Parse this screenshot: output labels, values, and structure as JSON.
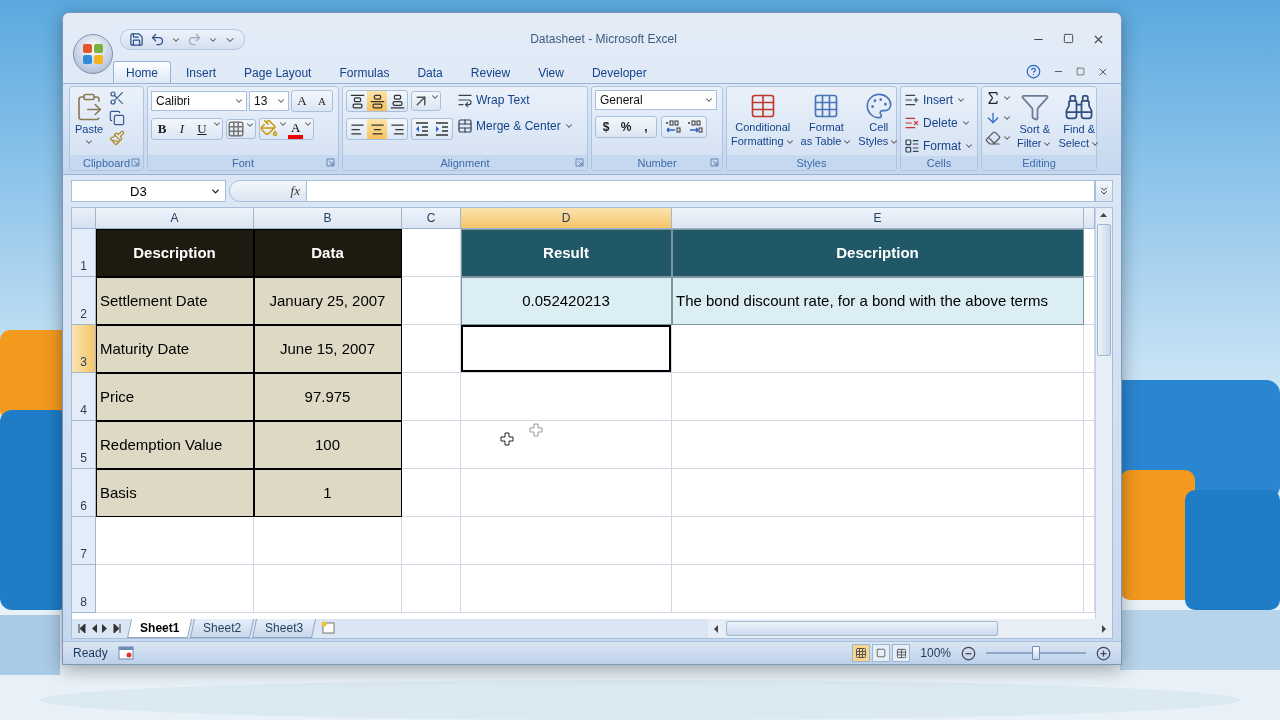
{
  "window": {
    "title": "Datasheet - Microsoft Excel"
  },
  "ribbon_tabs": [
    {
      "label": "Home",
      "selected": true
    },
    {
      "label": "Insert",
      "selected": false
    },
    {
      "label": "Page Layout",
      "selected": false
    },
    {
      "label": "Formulas",
      "selected": false
    },
    {
      "label": "Data",
      "selected": false
    },
    {
      "label": "Review",
      "selected": false
    },
    {
      "label": "View",
      "selected": false
    },
    {
      "label": "Developer",
      "selected": false
    }
  ],
  "clipboard": {
    "label": "Clipboard",
    "paste": "Paste"
  },
  "font": {
    "label": "Font",
    "name": "Calibri",
    "size": "13",
    "grow": "A",
    "shrink": "A",
    "styles": [
      "B",
      "I",
      "U"
    ],
    "color_letter": "A"
  },
  "alignment": {
    "label": "Alignment",
    "vertical": [
      {
        "selected": false
      },
      {
        "selected": true
      },
      {
        "selected": false
      }
    ],
    "horizontal": [
      {
        "selected": false
      },
      {
        "selected": true
      },
      {
        "selected": false
      }
    ],
    "wrap": "Wrap Text",
    "merge": "Merge & Center"
  },
  "number": {
    "label": "Number",
    "format": "General",
    "symbols": [
      "$",
      "%",
      ","
    ]
  },
  "styles": {
    "label": "Styles",
    "buttons": [
      {
        "line1": "Conditional",
        "line2": "Formatting"
      },
      {
        "line1": "Format",
        "line2": "as Table"
      },
      {
        "line1": "Cell",
        "line2": "Styles"
      }
    ]
  },
  "cells": {
    "label": "Cells",
    "buttons": [
      "Insert",
      "Delete",
      "Format"
    ]
  },
  "editing": {
    "label": "Editing",
    "buttons": [
      {
        "line1": "Sort &",
        "line2": "Filter"
      },
      {
        "line1": "Find &",
        "line2": "Select"
      }
    ]
  },
  "formula_bar": {
    "name_box": "D3",
    "fx": "fx"
  },
  "columns": [
    {
      "label": "A",
      "selected": false
    },
    {
      "label": "B",
      "selected": false
    },
    {
      "label": "C",
      "selected": false
    },
    {
      "label": "D",
      "selected": true
    },
    {
      "label": "E",
      "selected": false
    }
  ],
  "rows": [
    {
      "label": "1",
      "selected": false,
      "cells": [
        {
          "text": "Description",
          "kind": "header_dark",
          "selected": false
        },
        {
          "text": "Data",
          "kind": "header_dark",
          "selected": false
        },
        {
          "kind": "plain",
          "selected": false
        },
        {
          "text": "Result",
          "kind": "header_teal",
          "selected": false
        },
        {
          "text": "Description",
          "kind": "header_teal",
          "selected": false
        }
      ]
    },
    {
      "label": "2",
      "selected": false,
      "cells": [
        {
          "text": "Settlement Date",
          "kind": "label",
          "selected": false
        },
        {
          "text": "January 25, 2007",
          "kind": "value",
          "selected": false
        },
        {
          "kind": "plain",
          "selected": false
        },
        {
          "text": "0.052420213",
          "kind": "result",
          "selected": false
        },
        {
          "text": "The bond discount rate, for a bond with the above terms",
          "kind": "note",
          "selected": false
        }
      ]
    },
    {
      "label": "3",
      "selected": true,
      "cells": [
        {
          "text": "Maturity Date",
          "kind": "label",
          "selected": false
        },
        {
          "text": "June 15, 2007",
          "kind": "value",
          "selected": false
        },
        {
          "kind": "plain",
          "selected": false
        },
        {
          "kind": "plain",
          "selected": true
        },
        {
          "kind": "plain",
          "selected": false
        }
      ]
    },
    {
      "label": "4",
      "selected": false,
      "cells": [
        {
          "text": "Price",
          "kind": "label",
          "selected": false
        },
        {
          "text": "97.975",
          "kind": "value",
          "selected": false
        },
        {
          "kind": "plain",
          "selected": false
        },
        {
          "kind": "plain",
          "selected": false
        },
        {
          "kind": "plain",
          "selected": false
        }
      ]
    },
    {
      "label": "5",
      "selected": false,
      "cells": [
        {
          "text": "Redemption Value",
          "kind": "label",
          "selected": false
        },
        {
          "text": "100",
          "kind": "value",
          "selected": false
        },
        {
          "kind": "plain",
          "selected": false
        },
        {
          "kind": "plain",
          "selected": false
        },
        {
          "kind": "plain",
          "selected": false
        }
      ]
    },
    {
      "label": "6",
      "selected": false,
      "cells": [
        {
          "text": "Basis",
          "kind": "label",
          "selected": false
        },
        {
          "text": "1",
          "kind": "value",
          "selected": false
        },
        {
          "kind": "plain",
          "selected": false
        },
        {
          "kind": "plain",
          "selected": false
        },
        {
          "kind": "plain",
          "selected": false
        }
      ]
    },
    {
      "label": "7",
      "selected": false,
      "cells": [
        {
          "kind": "plain",
          "selected": false
        },
        {
          "kind": "plain",
          "selected": false
        },
        {
          "kind": "plain",
          "selected": false
        },
        {
          "kind": "plain",
          "selected": false
        },
        {
          "kind": "plain",
          "selected": false
        }
      ]
    },
    {
      "label": "8",
      "selected": false,
      "cells": [
        {
          "kind": "plain",
          "selected": false
        },
        {
          "kind": "plain",
          "selected": false
        },
        {
          "kind": "plain",
          "selected": false
        },
        {
          "kind": "plain",
          "selected": false
        },
        {
          "kind": "plain",
          "selected": false
        }
      ]
    }
  ],
  "sheet_tabs": [
    {
      "label": "Sheet1",
      "selected": true
    },
    {
      "label": "Sheet2",
      "selected": false
    },
    {
      "label": "Sheet3",
      "selected": false
    }
  ],
  "status_bar": {
    "text": "Ready",
    "zoom": "100%",
    "zoom_slider": {
      "level": 0.5
    }
  }
}
